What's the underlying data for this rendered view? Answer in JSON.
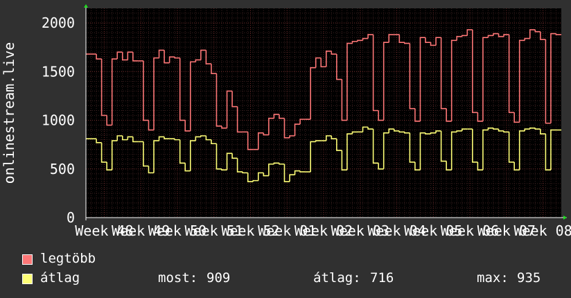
{
  "chart_data": {
    "type": "line",
    "ylabel": "onlinestream.live",
    "ylim": [
      0,
      2150
    ],
    "yticks": [
      0,
      500,
      1000,
      1500,
      2000
    ],
    "x_tick_labels": [
      "Week 48",
      "Week 49",
      "Week 50",
      "Week 51",
      "Week 52",
      "Week 01",
      "Week 02",
      "Week 03",
      "Week 04",
      "Week 05",
      "Week 06",
      "Week 07",
      "Week 08"
    ],
    "grid": true,
    "colors": {
      "background": "#303030",
      "plot": "#000000",
      "grid_minor": "#3c2020",
      "grid_major": "#6e2a2a",
      "axis": "#ffffff"
    },
    "series": [
      {
        "name": "legtöbb",
        "color": "#ff7777",
        "values": [
          1680,
          1680,
          1630,
          1050,
          950,
          1630,
          1700,
          1620,
          1700,
          1610,
          1610,
          1000,
          900,
          1640,
          1720,
          1590,
          1650,
          1640,
          1000,
          890,
          1600,
          1620,
          1720,
          1580,
          1480,
          940,
          920,
          1300,
          1140,
          880,
          880,
          700,
          700,
          870,
          850,
          1020,
          1060,
          1020,
          820,
          840,
          960,
          1010,
          1010,
          1540,
          1640,
          1550,
          1710,
          1680,
          1420,
          1000,
          1790,
          1810,
          1820,
          1840,
          1880,
          1100,
          1000,
          1800,
          1880,
          1880,
          1800,
          1790,
          1120,
          990,
          1850,
          1800,
          1770,
          1850,
          1120,
          990,
          1820,
          1860,
          1870,
          1930,
          1080,
          990,
          1850,
          1870,
          1890,
          1860,
          1880,
          1080,
          980,
          1820,
          1840,
          1930,
          1910,
          1830,
          970,
          1890,
          1880
        ]
      },
      {
        "name": "átlag",
        "color": "#ffff77",
        "values": [
          810,
          810,
          770,
          570,
          490,
          790,
          840,
          800,
          830,
          780,
          780,
          530,
          460,
          790,
          830,
          810,
          810,
          800,
          560,
          480,
          790,
          830,
          840,
          800,
          760,
          500,
          490,
          660,
          610,
          470,
          460,
          370,
          380,
          460,
          430,
          550,
          560,
          550,
          370,
          440,
          480,
          470,
          470,
          780,
          790,
          790,
          840,
          810,
          690,
          490,
          860,
          880,
          880,
          930,
          910,
          560,
          500,
          870,
          910,
          890,
          880,
          870,
          570,
          490,
          870,
          860,
          870,
          890,
          580,
          490,
          880,
          890,
          910,
          910,
          570,
          490,
          900,
          920,
          910,
          890,
          880,
          570,
          490,
          890,
          910,
          920,
          910,
          860,
          490,
          900,
          900
        ]
      }
    ]
  },
  "legend": {
    "series1_label": "legtöbb",
    "series2_label": "átlag"
  },
  "stats": {
    "now_label": "most:",
    "now_value": "909",
    "avg_label": "átlag:",
    "avg_value": "716",
    "max_label": "max:",
    "max_value": "935"
  }
}
